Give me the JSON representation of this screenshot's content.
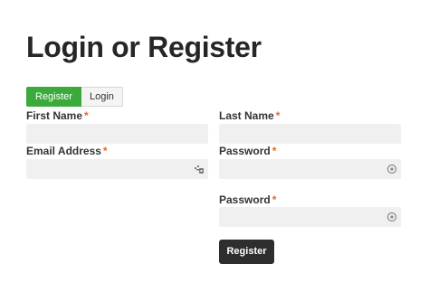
{
  "page": {
    "title": "Login or Register"
  },
  "tabs": [
    {
      "label": "Register",
      "active": true
    },
    {
      "label": "Login",
      "active": false
    }
  ],
  "form": {
    "required_marker": "*",
    "first_name": {
      "label": "First Name",
      "value": ""
    },
    "last_name": {
      "label": "Last Name",
      "value": ""
    },
    "email": {
      "label": "Email Address",
      "value": "",
      "icon": "autofill-key-icon"
    },
    "password": {
      "label": "Password",
      "value": "",
      "icon": "password-reveal-icon"
    },
    "password_confirm": {
      "label": "Password",
      "value": "",
      "icon": "password-reveal-icon"
    },
    "submit_label": "Register"
  },
  "colors": {
    "accent_green": "#3aab3a",
    "required_orange": "#e06a2b",
    "button_dark": "#2e2e2e",
    "field_bg": "#f0f0f0"
  }
}
